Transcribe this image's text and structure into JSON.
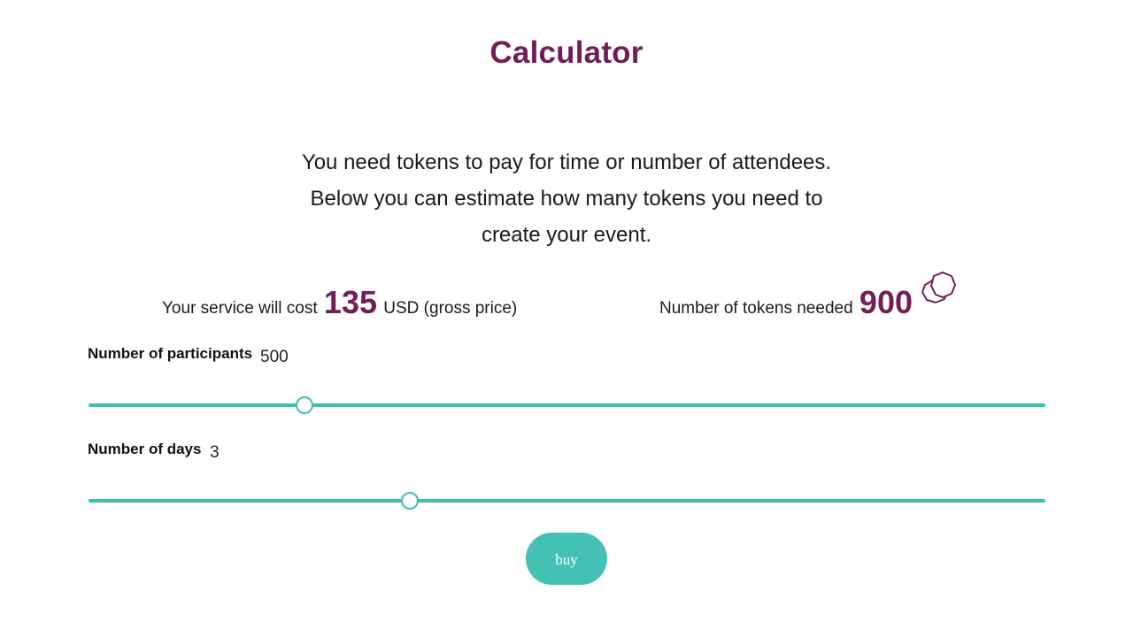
{
  "header": {
    "title": "Calculator"
  },
  "intro": {
    "line1": "You need tokens to pay for time or number of attendees.",
    "line2": "Below you can estimate how many tokens you need to",
    "line3": "create your event."
  },
  "summary": {
    "cost_prefix": "Your service will cost",
    "cost_value": "135",
    "cost_suffix": "USD (gross price)",
    "tokens_prefix": "Number of tokens needed",
    "tokens_value": "900",
    "tokens_icon": "token-octagon-icon"
  },
  "participants": {
    "label": "Number of participants",
    "value": "500",
    "slider_fraction": 0.226
  },
  "days": {
    "label": "Number of days",
    "value": "3",
    "slider_fraction": 0.336
  },
  "actions": {
    "buy_label": "buy"
  },
  "colors": {
    "accent": "#731d58",
    "slider": "#3cbfb1",
    "button": "#43c1b5"
  }
}
